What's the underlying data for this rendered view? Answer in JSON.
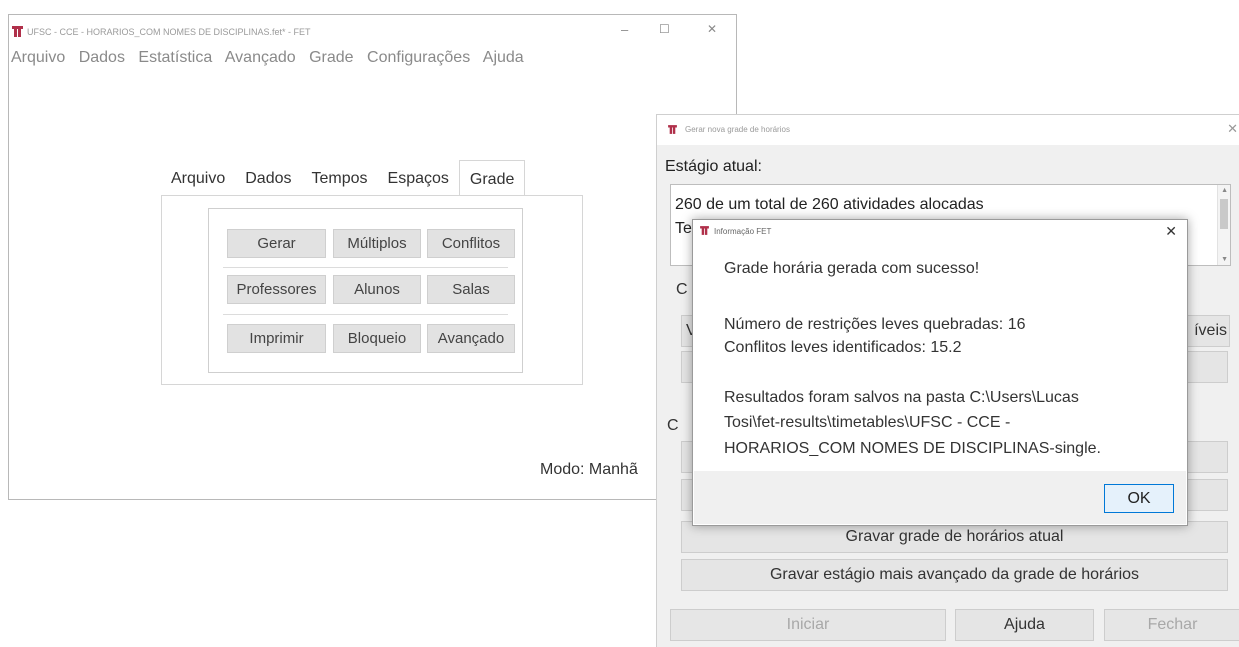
{
  "main_window": {
    "title": "UFSC - CCE - HORARIOS_COM NOMES DE DISCIPLINAS.fet* - FET",
    "controls": {
      "minimize": "–",
      "maximize": "☐",
      "close": "✕"
    },
    "menu": [
      "Arquivo",
      "Dados",
      "Estatística",
      "Avançado",
      "Grade",
      "Configurações",
      "Ajuda"
    ],
    "tabs": [
      "Arquivo",
      "Dados",
      "Tempos",
      "Espaços",
      "Grade"
    ],
    "active_tab": "Grade",
    "grade_buttons": {
      "gerar": "Gerar",
      "multiplos": "Múltiplos",
      "conflitos": "Conflitos",
      "professores": "Professores",
      "alunos": "Alunos",
      "salas": "Salas",
      "imprimir": "Imprimir",
      "bloqueio": "Bloqueio",
      "avancado": "Avançado"
    },
    "status_mode": "Modo: Manhã"
  },
  "gen_window": {
    "title": "Gerar nova grade de horários",
    "close": "✕",
    "stage_label": "Estágio atual:",
    "stage_line1": "260 de um total de 260 atividades alocadas",
    "stage_line2": "Te",
    "partial_c1": "C",
    "partial_v": "V",
    "partial_veis": "íveis",
    "partial_c2": "C",
    "buttons": {
      "gravar_atual": "Gravar grade de horários atual",
      "gravar_avancado": "Gravar estágio mais avançado da grade de horários",
      "iniciar": "Iniciar",
      "ajuda": "Ajuda",
      "fechar": "Fechar"
    }
  },
  "info_dialog": {
    "title": "Informação FET",
    "close": "✕",
    "line_success": "Grade horária gerada com sucesso!",
    "line_restricoes": "Número de restrições leves quebradas: 16",
    "line_conflitos": "Conflitos leves identificados: 15.2",
    "line_path1": "Resultados foram salvos na pasta C:\\Users\\Lucas",
    "line_path2": "Tosi\\fet-results\\timetables\\UFSC - CCE -",
    "line_path3": "HORARIOS_COM NOMES DE DISCIPLINAS-single.",
    "ok": "OK"
  }
}
